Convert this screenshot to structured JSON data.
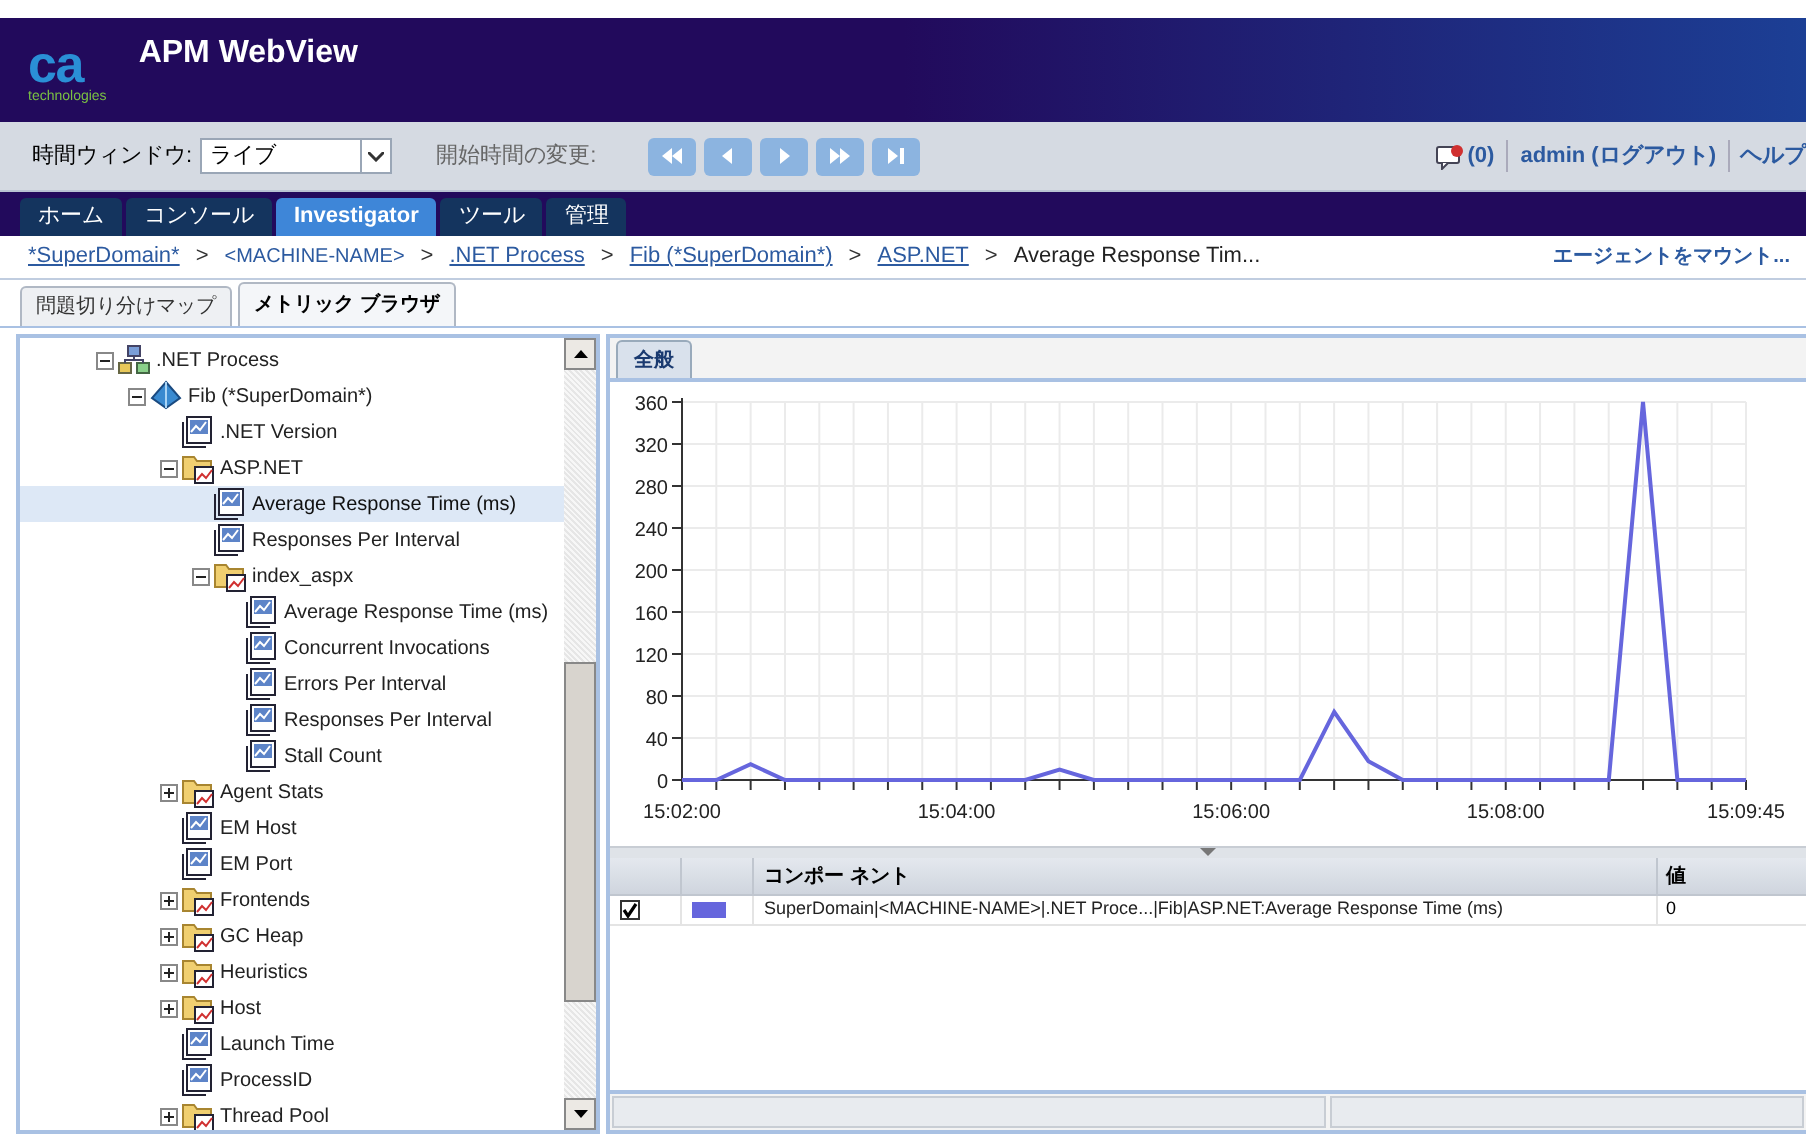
{
  "header": {
    "logo": {
      "mark": "ca",
      "tagline": "technologies"
    },
    "title": "APM WebView"
  },
  "toolbar": {
    "time_window_label": "時間ウィンドウ:",
    "time_window": {
      "value": "ライブ"
    },
    "start_time_label": "開始時間の変更:",
    "playback_buttons": [
      {
        "kind": "rewind",
        "disabled": true
      },
      {
        "kind": "back",
        "disabled": true
      },
      {
        "kind": "forward",
        "disabled": true
      },
      {
        "kind": "fastforward",
        "disabled": true
      },
      {
        "kind": "end",
        "disabled": true
      }
    ],
    "alerts": "(0)",
    "user": "admin (ログアウト)",
    "help": "ヘルプ"
  },
  "nav_tabs": [
    {
      "label": "ホーム",
      "selected": false
    },
    {
      "label": "コンソール",
      "selected": false
    },
    {
      "label": "Investigator",
      "selected": true
    },
    {
      "label": "ツール",
      "selected": false
    },
    {
      "label": "管理",
      "selected": false
    }
  ],
  "breadcrumb": {
    "items": [
      {
        "label": "*SuperDomain*",
        "kind": "link"
      },
      {
        "label": "<MACHINE-NAME>",
        "kind": "small"
      },
      {
        "label": ".NET Process",
        "kind": "link"
      },
      {
        "label": "Fib (*SuperDomain*)",
        "kind": "link"
      },
      {
        "label": "ASP.NET",
        "kind": "link"
      },
      {
        "label": "Average Response Tim...",
        "kind": "current"
      }
    ],
    "separator": ">",
    "action": "エージェントをマウント..."
  },
  "sub_tabs": [
    {
      "label": "問題切り分けマップ",
      "selected": false
    },
    {
      "label": "メトリック ブラウザ",
      "selected": true
    }
  ],
  "tree": [
    {
      "label": ".NET Process",
      "kind": "process",
      "selected": false,
      "expanded": true,
      "children": [
        {
          "label": "Fib (*SuperDomain*)",
          "kind": "agent",
          "selected": false,
          "expanded": true,
          "children": [
            {
              "label": ".NET Version",
              "kind": "metric",
              "selected": false
            },
            {
              "label": "ASP.NET",
              "kind": "folder",
              "selected": false,
              "expanded": true,
              "children": [
                {
                  "label": "Average Response Time (ms)",
                  "kind": "metric",
                  "selected": true
                },
                {
                  "label": "Responses Per Interval",
                  "kind": "metric",
                  "selected": false
                },
                {
                  "label": "index_aspx",
                  "kind": "folder",
                  "selected": false,
                  "expanded": true,
                  "children": [
                    {
                      "label": "Average Response Time (ms)",
                      "kind": "metric",
                      "selected": false
                    },
                    {
                      "label": "Concurrent Invocations",
                      "kind": "metric",
                      "selected": false
                    },
                    {
                      "label": "Errors Per Interval",
                      "kind": "metric",
                      "selected": false
                    },
                    {
                      "label": "Responses Per Interval",
                      "kind": "metric",
                      "selected": false
                    },
                    {
                      "label": "Stall Count",
                      "kind": "metric",
                      "selected": false
                    }
                  ]
                }
              ]
            },
            {
              "label": "Agent Stats",
              "kind": "folder",
              "selected": false,
              "expanded": false
            },
            {
              "label": "EM Host",
              "kind": "metric",
              "selected": false
            },
            {
              "label": "EM Port",
              "kind": "metric",
              "selected": false
            },
            {
              "label": "Frontends",
              "kind": "folder",
              "selected": false,
              "expanded": false
            },
            {
              "label": "GC Heap",
              "kind": "folder",
              "selected": false,
              "expanded": false
            },
            {
              "label": "Heuristics",
              "kind": "folder",
              "selected": false,
              "expanded": false
            },
            {
              "label": "Host",
              "kind": "folder",
              "selected": false,
              "expanded": false
            },
            {
              "label": "Launch Time",
              "kind": "metric",
              "selected": false
            },
            {
              "label": "ProcessID",
              "kind": "metric",
              "selected": false
            },
            {
              "label": "Thread Pool",
              "kind": "folder",
              "selected": false,
              "expanded": false
            }
          ]
        }
      ]
    }
  ],
  "panel": {
    "tabs": [
      {
        "label": "全般",
        "selected": true
      }
    ],
    "chart_data": {
      "type": "line",
      "categories": [
        "15:02:00",
        null,
        null,
        null,
        null,
        null,
        null,
        null,
        "15:04:00",
        null,
        null,
        null,
        null,
        null,
        null,
        null,
        "15:06:00",
        null,
        null,
        null,
        null,
        null,
        null,
        null,
        "15:08:00",
        null,
        null,
        null,
        null,
        null,
        null,
        "15:09:45"
      ],
      "series": [
        {
          "color": "#6666dd",
          "values": [
            0,
            0,
            15,
            0,
            0,
            0,
            0,
            0,
            0,
            0,
            0,
            10,
            0,
            0,
            0,
            0,
            0,
            0,
            0,
            65,
            18,
            0,
            0,
            0,
            0,
            0,
            0,
            0,
            360,
            0,
            0,
            0
          ]
        }
      ],
      "ylim": [
        0,
        360
      ],
      "grid": true,
      "yticks": [
        0,
        40,
        80,
        120,
        160,
        200,
        240,
        280,
        320,
        360
      ]
    },
    "table": {
      "columns": [
        "コンポー ネント",
        "値"
      ],
      "rows": [
        {
          "checked": true,
          "color": "#6666dd",
          "component": "SuperDomain|<MACHINE-NAME>|.NET Proce...|Fib|ASP.NET:Average Response Time (ms)",
          "value": "0"
        }
      ]
    }
  }
}
